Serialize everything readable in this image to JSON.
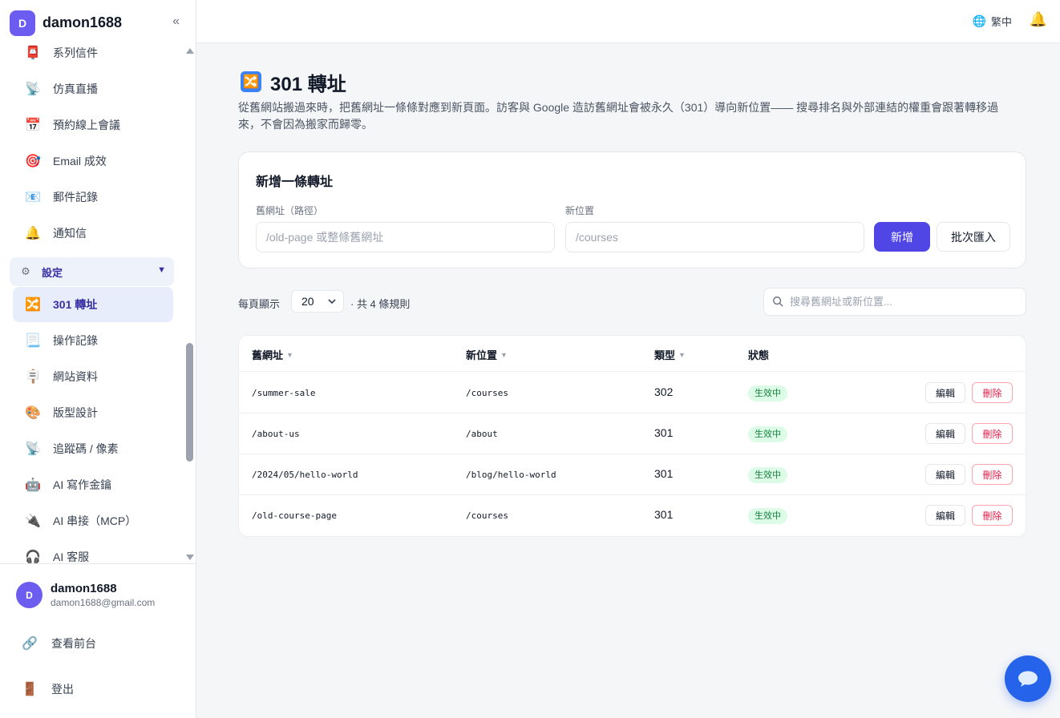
{
  "brand": {
    "avatar": "D",
    "name": "damon1688",
    "collapse": "«"
  },
  "nav": {
    "items": [
      {
        "label": "系列信件",
        "icon": "mail-series-icon",
        "glyph": "📮"
      },
      {
        "label": "仿真直播",
        "icon": "broadcast-icon",
        "glyph": "📡"
      },
      {
        "label": "預約線上會議",
        "icon": "calendar-icon",
        "glyph": "📅"
      },
      {
        "label": "Email 成效",
        "icon": "target-icon",
        "glyph": "🎯"
      },
      {
        "label": "郵件記錄",
        "icon": "mail-log-icon",
        "glyph": "📧"
      },
      {
        "label": "通知信",
        "icon": "bell-icon",
        "glyph": "🔔"
      }
    ],
    "group": {
      "label": "設定",
      "icon": "gear-icon",
      "glyph": "⚙",
      "caret": "▼"
    },
    "sub_items": [
      {
        "label": "301 轉址",
        "icon": "shuffle-icon",
        "glyph": "🔀",
        "active": true
      },
      {
        "label": "操作記錄",
        "icon": "document-icon",
        "glyph": "📃"
      },
      {
        "label": "網站資料",
        "icon": "signpost-icon",
        "glyph": "🪧"
      },
      {
        "label": "版型設計",
        "icon": "palette-icon",
        "glyph": "🎨"
      },
      {
        "label": "追蹤碼 / 像素",
        "icon": "satellite-icon",
        "glyph": "📡"
      },
      {
        "label": "AI 寫作金鑰",
        "icon": "robot-icon",
        "glyph": "🤖"
      },
      {
        "label": "AI 串接（MCP）",
        "icon": "plug-icon",
        "glyph": "🔌"
      },
      {
        "label": "AI 客服",
        "icon": "headset-icon",
        "glyph": "🎧"
      }
    ]
  },
  "user": {
    "avatar": "D",
    "name": "damon1688",
    "email": "damon1688@gmail.com"
  },
  "footer_links": [
    {
      "label": "查看前台",
      "icon": "link-icon",
      "glyph": "🔗"
    },
    {
      "label": "登出",
      "icon": "door-icon",
      "glyph": "🚪"
    }
  ],
  "topbar": {
    "lang": "繁中",
    "globe": "🌐",
    "bell": "🔔"
  },
  "page": {
    "title": "301 轉址",
    "title_icon": "🔀",
    "description": "從舊網站搬過來時，把舊網址一條條對應到新頁面。訪客與 Google 造訪舊網址會被永久（301）導向新位置—— 搜尋排名與外部連結的權重會跟著轉移過來，不會因為搬家而歸零。"
  },
  "form": {
    "title": "新增一條轉址",
    "old_label": "舊網址（路徑）",
    "old_placeholder": "/old-page 或整條舊網址",
    "new_label": "新位置",
    "new_placeholder": "/courses",
    "add_button": "新增",
    "import_button": "批次匯入"
  },
  "list": {
    "per_page_label": "每頁顯示",
    "per_page_value": "20",
    "total": "· 共 4 條規則",
    "search_placeholder": "搜尋舊網址或新位置..."
  },
  "table": {
    "headers": {
      "old": "舊網址",
      "new": "新位置",
      "type": "類型",
      "status": "狀態"
    },
    "sort_glyph": "▼",
    "rows": [
      {
        "old": "/summer-sale",
        "new": "/courses",
        "type": "302",
        "status": "生效中",
        "edit": "編輯",
        "delete": "刪除"
      },
      {
        "old": "/about-us",
        "new": "/about",
        "type": "301",
        "status": "生效中",
        "edit": "編輯",
        "delete": "刪除"
      },
      {
        "old": "/2024/05/hello-world",
        "new": "/blog/hello-world",
        "type": "301",
        "status": "生效中",
        "edit": "編輯",
        "delete": "刪除"
      },
      {
        "old": "/old-course-page",
        "new": "/courses",
        "type": "301",
        "status": "生效中",
        "edit": "編輯",
        "delete": "刪除"
      }
    ]
  },
  "colors": {
    "accent": "#4f46e5",
    "brand": "#6d5cf0",
    "fab": "#2563eb",
    "status_active": "#15803d",
    "danger": "#e11d48"
  }
}
